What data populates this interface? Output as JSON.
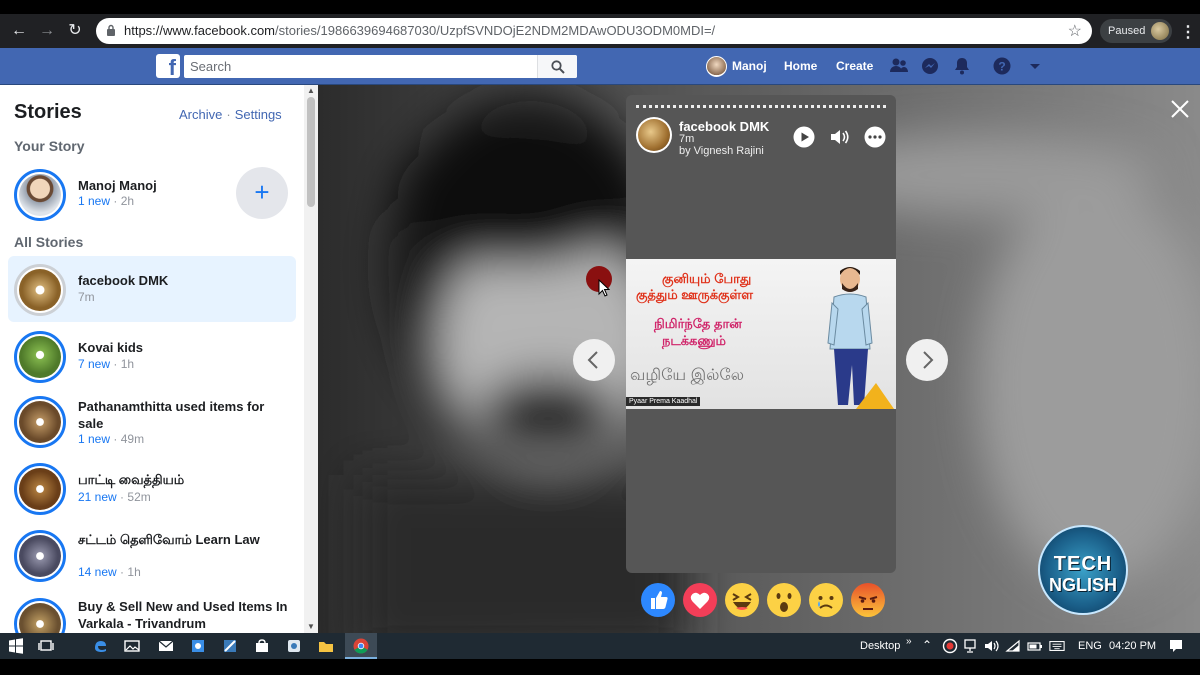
{
  "browser": {
    "url_host": "https://www.facebook.com",
    "url_path": "/stories/1986639694687030/UzpfSVNDOjE2NDM2MDAwODU3ODM0MDI=/",
    "profile_status": "Paused"
  },
  "facebook_bar": {
    "logo": "f",
    "search_placeholder": "Search",
    "profile_name": "Manoj",
    "home_label": "Home",
    "create_label": "Create"
  },
  "sidebar": {
    "title": "Stories",
    "archive_label": "Archive",
    "link_separator": "·",
    "settings_label": "Settings",
    "your_story_heading": "Your Story",
    "my_story": {
      "name": "Manoj Manoj",
      "new": "1 new",
      "separator": "·",
      "time": "2h"
    },
    "add_label": "+",
    "all_stories_heading": "All Stories",
    "stories": [
      {
        "name": "facebook DMK",
        "new": "",
        "separator": "",
        "time": "7m",
        "active": true
      },
      {
        "name": "Kovai kids",
        "new": "7 new",
        "separator": "·",
        "time": "1h"
      },
      {
        "name": "Pathanamthitta used items for sale",
        "new": "1 new",
        "separator": "·",
        "time": "49m"
      },
      {
        "name": "பாட்டி வைத்தியம்",
        "new": "21 new",
        "separator": "·",
        "time": "52m"
      },
      {
        "name": "சட்டம் தெளிவோம் Learn Law",
        "new": "14 new",
        "separator": "·",
        "time": "1h"
      },
      {
        "name": "Buy & Sell New and Used Items In Varkala - Trivandrum",
        "new": "",
        "separator": "",
        "time": ""
      }
    ]
  },
  "viewer": {
    "story_owner": "facebook DMK",
    "story_time": "7m",
    "story_by": "by Vignesh Rajini",
    "image_text": {
      "line1": "குனியும் போது",
      "line2": "குத்தும் ஊருக்குள்ள",
      "line3": "நிமிர்ந்தே தான்",
      "line4": "நடக்கணும்",
      "line5": "வழியே இல்லே",
      "tag": "Pyaar Prema Kaadhal"
    },
    "reactions": [
      "like",
      "love",
      "haha",
      "wow",
      "sad",
      "angry"
    ],
    "badge_line1": "TECH",
    "badge_line2": "NGLISH"
  },
  "taskbar": {
    "desktop_label": "Desktop",
    "lang": "ENG",
    "clock": "04:20 PM"
  },
  "colors": {
    "facebook_blue": "#4267b2",
    "story_ring": "#1877f2",
    "active_story_bg": "#e7f3ff"
  }
}
